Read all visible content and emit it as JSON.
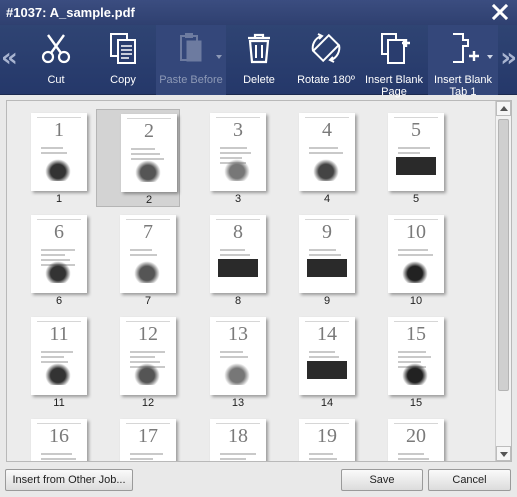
{
  "window": {
    "title": "#1037: A_sample.pdf"
  },
  "toolbar": {
    "tools": [
      {
        "label": "Cut",
        "icon": "scissors-icon",
        "disabled": false
      },
      {
        "label": "Copy",
        "icon": "copy-icon",
        "disabled": false
      },
      {
        "label": "Paste Before",
        "icon": "paste-icon",
        "disabled": true
      },
      {
        "label": "Delete",
        "icon": "trash-icon",
        "disabled": false
      },
      {
        "label": "Rotate 180º",
        "icon": "rotate-icon",
        "disabled": false
      },
      {
        "label": "Insert Blank Page",
        "icon": "insert-page-icon",
        "disabled": false
      },
      {
        "label": "Insert Blank Tab 1",
        "icon": "insert-tab-icon",
        "disabled": false
      }
    ]
  },
  "pages": [
    {
      "number": "1",
      "caption": "1"
    },
    {
      "number": "2",
      "caption": "2",
      "selected": true
    },
    {
      "number": "3",
      "caption": "3"
    },
    {
      "number": "4",
      "caption": "4"
    },
    {
      "number": "5",
      "caption": "5"
    },
    {
      "number": "6",
      "caption": "6"
    },
    {
      "number": "7",
      "caption": "7"
    },
    {
      "number": "8",
      "caption": "8"
    },
    {
      "number": "9",
      "caption": "9"
    },
    {
      "number": "10",
      "caption": "10"
    },
    {
      "number": "11",
      "caption": "11"
    },
    {
      "number": "12",
      "caption": "12"
    },
    {
      "number": "13",
      "caption": "13"
    },
    {
      "number": "14",
      "caption": "14"
    },
    {
      "number": "15",
      "caption": "15"
    },
    {
      "number": "16",
      "caption": ""
    },
    {
      "number": "17",
      "caption": ""
    },
    {
      "number": "18",
      "caption": ""
    },
    {
      "number": "19",
      "caption": ""
    },
    {
      "number": "20",
      "caption": ""
    }
  ],
  "footer": {
    "insert_label": "Insert from Other Job...",
    "save_label": "Save",
    "cancel_label": "Cancel"
  },
  "colors": {
    "title_bar": "#2f4070",
    "toolbar": "#2a3d6e",
    "selected_cell": "#d3d3d3"
  }
}
